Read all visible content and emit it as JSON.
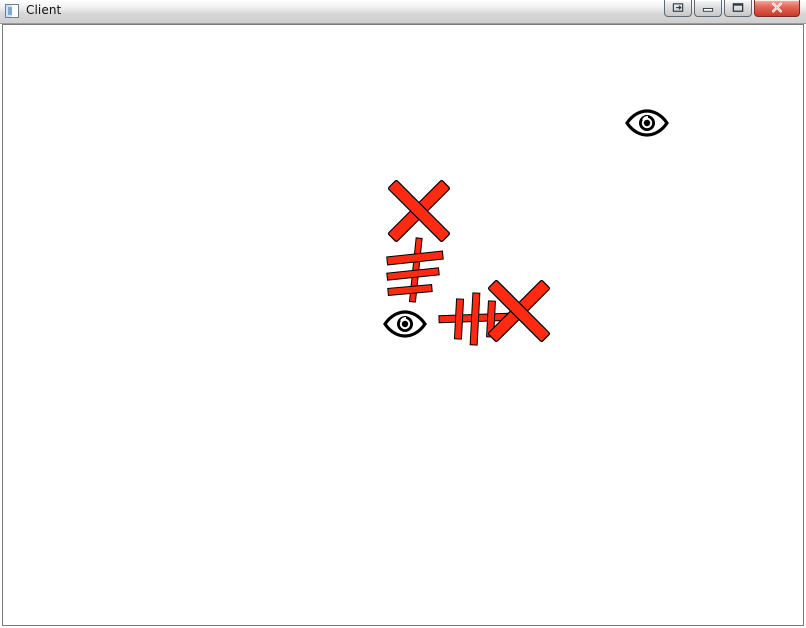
{
  "window": {
    "title": "Client",
    "icon": "app-window-icon",
    "caption_buttons": [
      {
        "name": "restore-snap-button",
        "icon": "switch-window-icon"
      },
      {
        "name": "minimize-button",
        "icon": "minimize-icon"
      },
      {
        "name": "maximize-button",
        "icon": "maximize-icon"
      },
      {
        "name": "close-button",
        "icon": "close-icon"
      }
    ]
  },
  "scene": {
    "background": "#ffffff",
    "colors": {
      "red_marker": "#ff2a12",
      "outline": "#000000",
      "eye": "#000000"
    },
    "items": [
      {
        "id": "eye1",
        "type": "eye",
        "icon": "eye-icon"
      },
      {
        "id": "cross1",
        "type": "x-marker",
        "icon": "x-marker-icon"
      },
      {
        "id": "ladder1",
        "type": "red-tally-marker",
        "icon": "tally-icon"
      },
      {
        "id": "eye2",
        "type": "eye",
        "icon": "eye-icon"
      },
      {
        "id": "ladder2",
        "type": "red-tally-marker",
        "icon": "tally-icon"
      },
      {
        "id": "cross2",
        "type": "x-marker",
        "icon": "x-marker-icon"
      }
    ]
  }
}
